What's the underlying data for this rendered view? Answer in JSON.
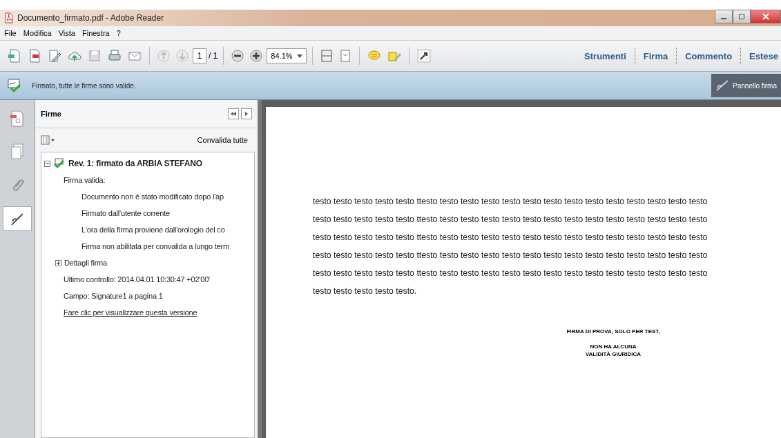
{
  "window": {
    "title": "Documento_firmato.pdf - Adobe Reader"
  },
  "menu": [
    "File",
    "Modifica",
    "Vista",
    "Finestra",
    "?"
  ],
  "toolbar": {
    "page": "1",
    "page_total": "/ 1",
    "zoom": "84.1%",
    "panes": [
      "Strumenti",
      "Firma",
      "Commento",
      "Estese"
    ]
  },
  "notification": {
    "message": "Firmato, tutte le firme sono valide.",
    "button": "Pannello firma"
  },
  "signatures_panel": {
    "title": "Firme",
    "validate_all": "Convalida tutte",
    "tree": [
      {
        "label": "Rev. 1: firmato da ARBIA STEFANO",
        "expanded": true,
        "children": [
          {
            "label": "Firma valida:",
            "children": [
              {
                "label": "Documento non è stato modificato dopo l'ap"
              },
              {
                "label": "Firmato dall'utente corrente"
              },
              {
                "label": "L'ora della firma proviene dall'orologio del co"
              },
              {
                "label": "Firma non abilitata per convalida a lungo term"
              }
            ]
          },
          {
            "label": "Dettagli firma",
            "expanded": false
          },
          {
            "label": "Ultimo controllo: 2014.04.01 10:30:47 +02'00'"
          },
          {
            "label": "Campo: Signature1 a pagina 1"
          },
          {
            "label": "Fare clic per visualizzare questa versione",
            "kind": "link"
          }
        ]
      }
    ]
  },
  "document": {
    "paragraph": [
      "testo testo testo testo testo ttesto testo testo testo testo testo testo testo testo testo testo testo testo testo",
      "testo testo testo testo testo ttesto testo testo testo testo testo testo testo testo testo testo testo testo testo",
      "testo testo testo testo testo ttesto testo testo testo testo testo testo testo testo testo testo testo testo testo",
      "testo testo testo testo testo ttesto testo testo testo testo testo testo testo testo testo testo testo testo testo",
      "testo testo testo testo testo ttesto testo testo testo testo testo testo testo testo testo testo testo testo testo",
      "testo testo testo testo testo."
    ],
    "signature_stamp": [
      "FIRMA DI PROVA, SOLO PER TEST,",
      "NON HA ALCUNA",
      "VALIDITÀ GIURIDICA"
    ]
  }
}
